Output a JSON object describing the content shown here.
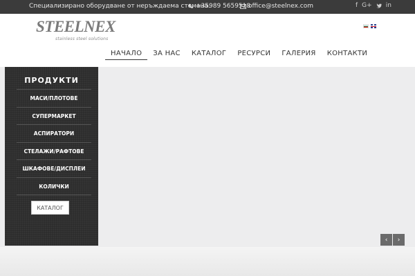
{
  "topbar": {
    "tagline": "Специализирано оборудване от неръждаема стомана.",
    "phone": "+35989 5659518",
    "email": "office@steelnex.com",
    "social": [
      "f",
      "G+",
      "t",
      "in"
    ]
  },
  "header": {
    "logo_word": "STEELNEX",
    "logo_tagline": "stainless steel solutions",
    "languages": [
      "bg",
      "en"
    ]
  },
  "nav": {
    "items": [
      "НАЧАЛО",
      "ЗА НАС",
      "КАТАЛОГ",
      "РЕСУРСИ",
      "ГАЛЕРИЯ",
      "КОНТАКТИ"
    ],
    "active_index": 0
  },
  "sidebar": {
    "title": "ПРОДУКТИ",
    "items": [
      "МАСИ/ПЛОТОВЕ",
      "СУПЕРМАРКЕТ",
      "АСПИРАТОРИ",
      "СТЕЛАЖИ/РАФТОВЕ",
      "ШКАФОВЕ/ДИСПЛЕИ",
      "КОЛИЧКИ"
    ],
    "button_label": "КАТАЛОГ"
  },
  "slider": {
    "prev_icon": "‹",
    "next_icon": "›"
  }
}
